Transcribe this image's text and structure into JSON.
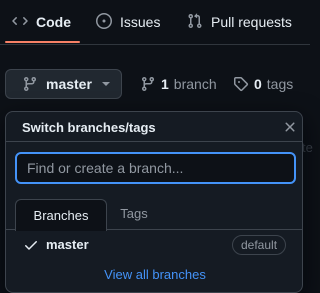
{
  "nav": {
    "code": "Code",
    "issues": "Issues",
    "pull_requests": "Pull requests",
    "active_color": "#f78166"
  },
  "branch_button": {
    "label": "master"
  },
  "meta": {
    "branch_count": "1",
    "branch_label": "branch",
    "tag_count": "0",
    "tag_label": "tags"
  },
  "popup": {
    "title": "Switch branches/tags",
    "search_placeholder": "Find or create a branch...",
    "tabs": [
      "Branches",
      "Tags"
    ],
    "active_tab": "Branches",
    "branches": [
      {
        "name": "master",
        "badge": "default",
        "selected": true
      }
    ],
    "view_all": "View all branches"
  },
  "peek_text": "te",
  "colors": {
    "accent_link": "#4493f8",
    "focus_border": "#4493f8"
  }
}
